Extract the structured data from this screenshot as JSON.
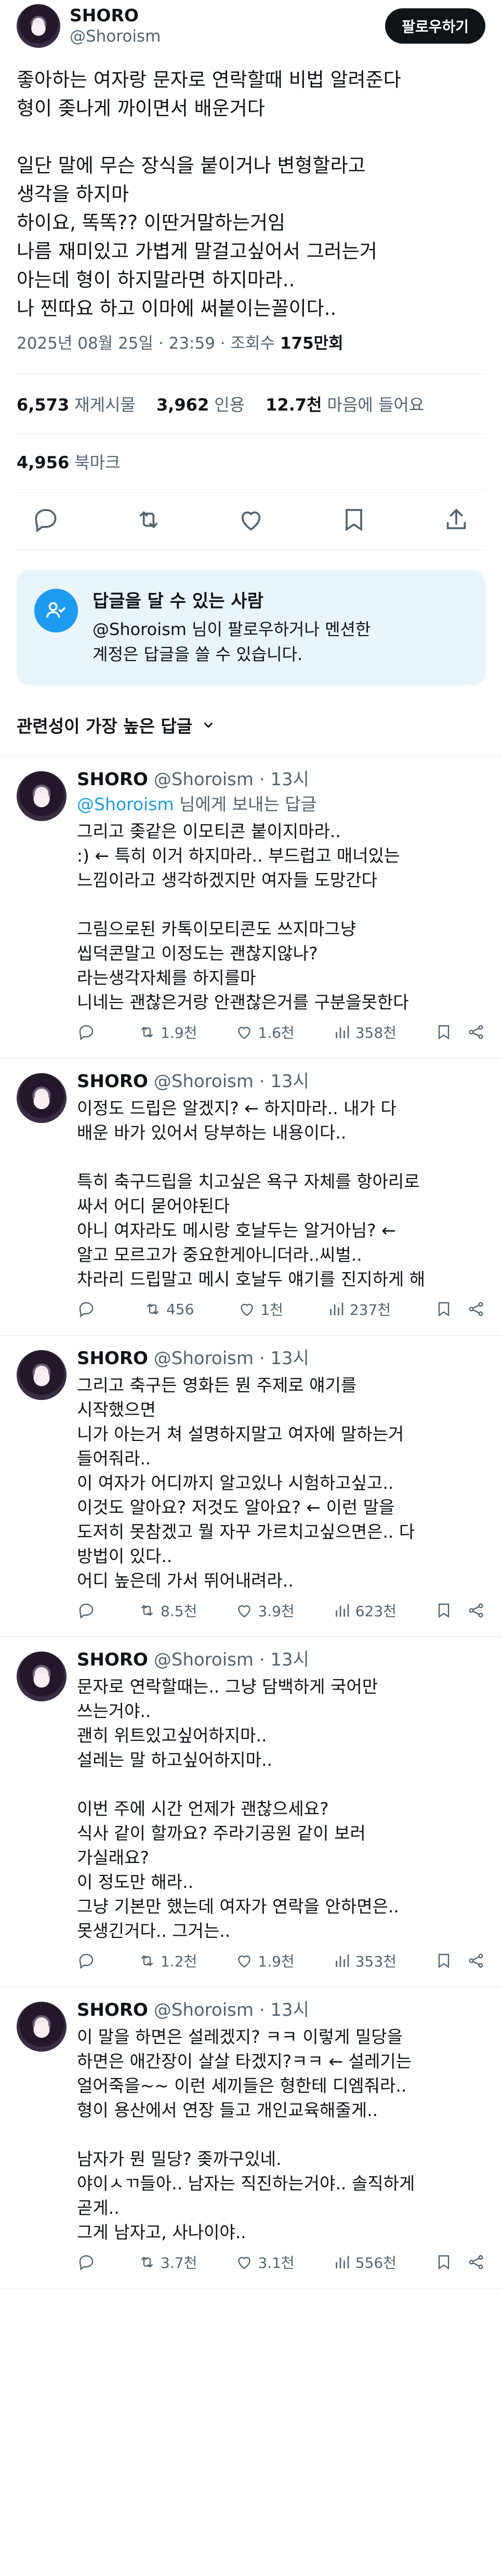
{
  "tweet": {
    "author_name": "SHORO",
    "author_handle": "@Shoroism",
    "follow_label": "팔로우하기",
    "text": "좋아하는 여자랑 문자로 연락할때 비법 알려준다\n형이 좆나게 까이면서 배운거다\n\n일단 말에 무슨 장식을 붙이거나 변형할라고\n생각을 하지마\n하이요, 똑똑?? 이딴거말하는거임\n나름 재미있고 가볍게 말걸고싶어서 그러는거\n아는데 형이 하지말라면 하지마라..\n나 찐따요 하고 이마에 써붙이는꼴이다..",
    "time": "2025년 08월 25일 · 23:59 · 조회수",
    "views": "175만회",
    "retweets_count": "6,573",
    "retweets_label": "재게시물",
    "quotes_count": "3,962",
    "quotes_label": "인용",
    "likes_count": "12.7천",
    "likes_label": "마음에 들어요",
    "bookmarks_count": "4,956",
    "bookmarks_label": "북마크"
  },
  "reply_restriction": {
    "title": "답글을 달 수 있는 사람",
    "body": "@Shoroism 님이 팔로우하거나 멘션한\n계정은 답글을 쓸 수 있습니다."
  },
  "sort_label": "관련성이 가장 높은 답글",
  "replies": [
    {
      "name": "SHORO",
      "handle": "@Shoroism · 13시",
      "reply_to_mention": "@Shoroism",
      "reply_to_suffix": " 님에게 보내는 답글",
      "text": "그리고 좆같은 이모티콘 붙이지마라..\n:) ← 특히 이거 하지마라.. 부드럽고 매너있는\n느낌이라고 생각하겠지만  여자들 도망간다\n\n그림으로된 카톡이모티콘도 쓰지마그냥\n씹덕콘말고 이정도는 괜찮지않나?\n라는생각자체를 하지를마\n니네는 괜찮은거랑 안괜찮은거를 구분을못한다",
      "replies": "",
      "retweets": "1.9천",
      "likes": "1.6천",
      "views": "358천"
    },
    {
      "name": "SHORO",
      "handle": "@Shoroism · 13시",
      "text": "이정도 드립은 알겠지? ← 하지마라.. 내가 다\n배운 바가 있어서 당부하는 내용이다..\n\n특히 축구드립을 치고싶은 욕구 자체를 항아리로\n싸서 어디 묻어야된다\n아니 여자라도 메시랑 호날두는 알거아님? ←\n알고 모르고가 중요한게아니더라..씨벌..\n차라리 드립말고 메시 호날두 얘기를 진지하게 해",
      "replies": "",
      "retweets": "456",
      "likes": "1천",
      "views": "237천"
    },
    {
      "name": "SHORO",
      "handle": "@Shoroism · 13시",
      "text": "그리고 축구든 영화든 뭔 주제로 얘기를\n시작했으면\n니가 아는거 쳐 설명하지말고 여자에 말하는거\n들어줘라..\n이 여자가 어디까지 알고있나 시험하고싶고..\n이것도 알아요? 저것도 알아요? ← 이런 말을\n도저히 못참겠고 뭘 자꾸 가르치고싶으면은.. 다\n방법이 있다..\n어디 높은데 가서 뛰어내려라..",
      "replies": "",
      "retweets": "8.5천",
      "likes": "3.9천",
      "views": "623천"
    },
    {
      "name": "SHORO",
      "handle": "@Shoroism · 13시",
      "text": "문자로 연락할때는.. 그냥 담백하게 국어만\n쓰는거야..\n괜히 위트있고싶어하지마..\n설레는 말 하고싶어하지마..\n\n이번 주에 시간 언제가 괜찮으세요?\n식사 같이 할까요? 주라기공원 같이 보러\n가실래요?\n이 정도만 해라..\n그냥 기본만 했는데 여자가 연락을 안하면은..\n못생긴거다.. 그거는..",
      "replies": "",
      "retweets": "1.2천",
      "likes": "1.9천",
      "views": "353천"
    },
    {
      "name": "SHORO",
      "handle": "@Shoroism · 13시",
      "text": "이 말을 하면은 설레겠지? ㅋㅋ 이렇게 밀당을\n하면은 애간장이 살살 타겠지?ㅋㅋ ← 설레기는\n얼어죽을~~ 이런 세끼들은 형한테 디엠줘라..\n형이 용산에서 연장 들고 개인교육해줄게..\n\n남자가 뭔 밀당? 좆까구있네.\n야이ㅅㄲ들아.. 남자는 직진하는거야.. 솔직하게\n곧게..\n그게 남자고, 사나이야..",
      "replies": "",
      "retweets": "3.7천",
      "likes": "3.1천",
      "views": "556천"
    }
  ]
}
